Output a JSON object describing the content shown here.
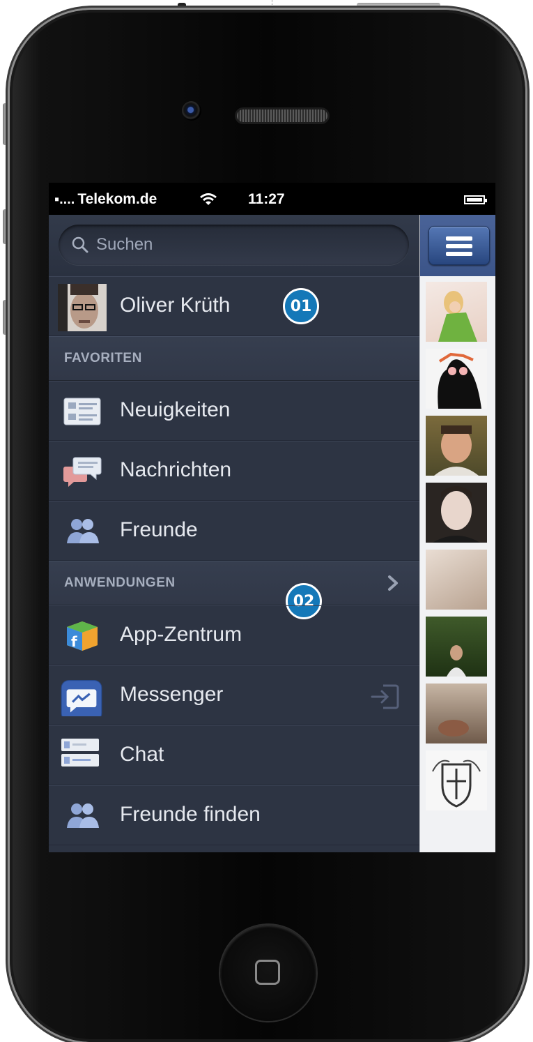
{
  "status_bar": {
    "signal": "▪....",
    "carrier": "Telekom.de",
    "time": "11:27"
  },
  "search": {
    "placeholder": "Suchen"
  },
  "profile": {
    "name": "Oliver Krüth"
  },
  "sections": {
    "favorites": "FAVORITEN",
    "apps": "ANWENDUNGEN"
  },
  "favorites": [
    {
      "label": "Neuigkeiten",
      "icon": "news-feed-icon"
    },
    {
      "label": "Nachrichten",
      "icon": "messages-icon"
    },
    {
      "label": "Freunde",
      "icon": "friends-icon"
    }
  ],
  "apps": [
    {
      "label": "App-Zentrum",
      "icon": "app-center-icon"
    },
    {
      "label": "Messenger",
      "icon": "messenger-icon"
    },
    {
      "label": "Chat",
      "icon": "chat-icon"
    },
    {
      "label": "Freunde finden",
      "icon": "find-friends-icon"
    }
  ],
  "callouts": [
    "01",
    "02"
  ],
  "friends_rail": {
    "count": 8,
    "icons": [
      "menu-icon"
    ]
  },
  "colors": {
    "sidebar_bg": "#2d3443",
    "section_bg": "#363e4f",
    "nav_blue": "#3b5488",
    "callout_blue": "#1478b8"
  }
}
